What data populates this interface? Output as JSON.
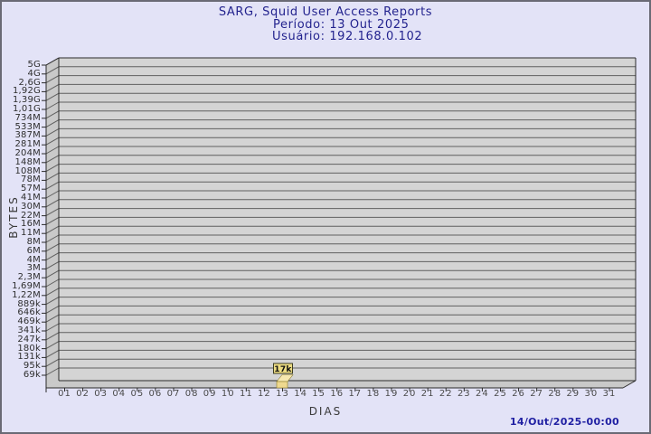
{
  "header": {
    "title": "SARG, Squid User Access Reports",
    "period": "Período: 13 Out 2025",
    "user": "Usuário: 192.168.0.102"
  },
  "footer": {
    "timestamp": "14/Out/2025-00:00"
  },
  "chart_data": {
    "type": "bar",
    "title": "SARG, Squid User Access Reports",
    "subtitle": "Período: 13 Out 2025",
    "subject": "Usuário: 192.168.0.102",
    "xlabel": "DIAS",
    "ylabel": "BYTES",
    "y_scale": "log",
    "grid": "horizontal",
    "legend": "none",
    "y_tick_labels": [
      "5G",
      "4G",
      "2,6G",
      "1,92G",
      "1,39G",
      "1,01G",
      "734M",
      "533M",
      "387M",
      "281M",
      "204M",
      "148M",
      "108M",
      "78M",
      "57M",
      "41M",
      "30M",
      "22M",
      "16M",
      "11M",
      "8M",
      "6M",
      "4M",
      "3M",
      "2,3M",
      "1,69M",
      "1,22M",
      "889k",
      "646k",
      "469k",
      "341k",
      "247k",
      "180k",
      "131k",
      "95k",
      "69k"
    ],
    "categories": [
      "01",
      "02",
      "03",
      "04",
      "05",
      "06",
      "07",
      "08",
      "09",
      "10",
      "11",
      "12",
      "13",
      "14",
      "15",
      "16",
      "17",
      "18",
      "19",
      "20",
      "21",
      "22",
      "23",
      "24",
      "25",
      "26",
      "27",
      "28",
      "29",
      "30",
      "31"
    ],
    "values": [
      0,
      0,
      0,
      0,
      0,
      0,
      0,
      0,
      0,
      0,
      0,
      0,
      17000,
      0,
      0,
      0,
      0,
      0,
      0,
      0,
      0,
      0,
      0,
      0,
      0,
      0,
      0,
      0,
      0,
      0,
      0
    ],
    "bars": [
      {
        "day": "13",
        "label": "17k",
        "value_bytes": 17000
      }
    ]
  },
  "colors": {
    "background": "#e3e3f7",
    "frame_border": "#6a6a75",
    "title_text": "#23238e",
    "timestamp_text": "#2121a3",
    "plot_face": "#d4d4d4",
    "plot_wall": "#c9c9c9",
    "grid_line": "#5f5f5f",
    "axis_line": "#2b2b2b",
    "tick_text": "#2e2e2e",
    "day_text": "#4a4a4a",
    "bar_fill_front": "#efd98f",
    "bar_fill_top": "#f6e8b0",
    "bar_edge": "#8a7a2a",
    "bar_label_bg": "#ecdc82",
    "bar_label_border": "#3c3c20",
    "bar_label_text": "#111111"
  }
}
